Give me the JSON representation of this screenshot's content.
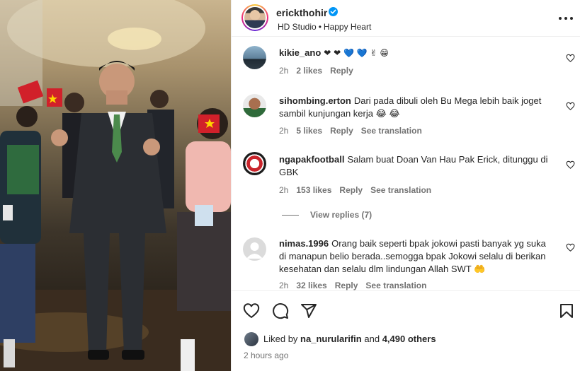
{
  "post": {
    "username": "erickthohir",
    "subtitle_left": "HD Studio",
    "subtitle_sep": "•",
    "subtitle_right": "Happy Heart"
  },
  "comments": [
    {
      "username": "kikie_ano",
      "text": "❤ ❤ 💙 💙 ✌ 😁",
      "time": "2h",
      "likes": "2 likes",
      "reply": "Reply",
      "translate": ""
    },
    {
      "username": "sihombing.erton",
      "text": "Dari pada dibuli oleh Bu Mega lebih baik joget sambil kunjungan kerja 😂 😂",
      "time": "2h",
      "likes": "5 likes",
      "reply": "Reply",
      "translate": "See translation"
    },
    {
      "username": "ngapakfootball",
      "text": "Salam buat Doan Van Hau Pak Erick, ditunggu di GBK",
      "time": "2h",
      "likes": "153 likes",
      "reply": "Reply",
      "translate": "See translation"
    },
    {
      "username": "nimas.1996",
      "text": "Orang baik seperti bpak jokowi pasti banyak yg suka di manapun belio berada..semogga bpak Jokowi selalu di berikan kesehatan dan selalu dlm lindungan Allah SWT 🤲",
      "time": "2h",
      "likes": "32 likes",
      "reply": "Reply",
      "translate": "See translation"
    }
  ],
  "view_replies": "View replies (7)",
  "likes": {
    "prefix": "Liked by",
    "user": "na_nurularifin",
    "and": "and",
    "others": "4,490 others"
  },
  "posted_time": "2 hours ago",
  "icons": [
    "heart-icon",
    "comment-icon",
    "share-icon",
    "save-icon",
    "more-icon",
    "verified-icon"
  ],
  "colors": {
    "verified": "#0095f6",
    "meta": "#737373",
    "text": "#262626"
  }
}
